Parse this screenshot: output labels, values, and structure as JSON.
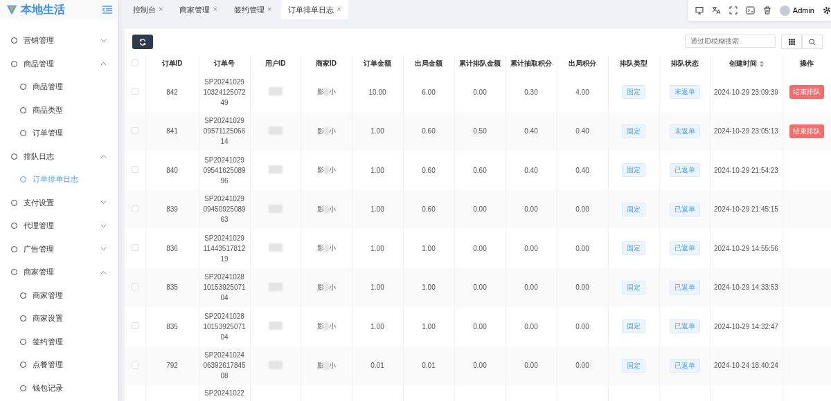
{
  "brand": {
    "title": "本地生活"
  },
  "sidebar": {
    "items": [
      {
        "label": "营销管理",
        "expanded": false
      },
      {
        "label": "商品管理",
        "expanded": true,
        "children": [
          {
            "label": "商品管理",
            "selected": false
          },
          {
            "label": "商品类型",
            "selected": false
          },
          {
            "label": "订单管理",
            "selected": false
          }
        ]
      },
      {
        "label": "排队日志",
        "expanded": true,
        "children": [
          {
            "label": "订单排单日志",
            "selected": true
          }
        ]
      },
      {
        "label": "支付设置",
        "expanded": false
      },
      {
        "label": "代理管理",
        "expanded": false
      },
      {
        "label": "广告管理",
        "expanded": false
      },
      {
        "label": "商家管理",
        "expanded": true,
        "children": [
          {
            "label": "商家管理",
            "selected": false
          },
          {
            "label": "商家设置",
            "selected": false
          },
          {
            "label": "签约管理",
            "selected": false
          },
          {
            "label": "点餐管理",
            "selected": false
          },
          {
            "label": "钱包记录",
            "selected": false
          }
        ]
      }
    ]
  },
  "tabs": [
    {
      "label": "控制台",
      "close": "×",
      "selected": false
    },
    {
      "label": "商家管理",
      "close": "×",
      "selected": false
    },
    {
      "label": "签约管理",
      "close": "×",
      "selected": false
    },
    {
      "label": "订单排单日志",
      "close": "×",
      "selected": true
    }
  ],
  "user": {
    "name": "Admin"
  },
  "search": {
    "placeholder": "通过ID模糊搜索"
  },
  "table": {
    "select_all": {
      "checked": false
    },
    "columns": [
      "订单ID",
      "订单号",
      "用户ID",
      "商家ID",
      "订单金额",
      "出局金额",
      "累计排队金额",
      "累计抽取积分",
      "出局积分",
      "排队类型",
      "排队状态",
      "创建时间",
      "操作"
    ],
    "rows": [
      {
        "checked": false,
        "id": "842",
        "order_no": [
          "SP20241029",
          "10324125072",
          "49"
        ],
        "merchant": [
          "影",
          "小"
        ],
        "amount": "10.00",
        "out_amount": "6.00",
        "queue_total": "0.00",
        "points_total": "0.30",
        "out_points": "4.00",
        "type": "固定",
        "status": "未返单",
        "created": "2024-10-29 23:09:39",
        "action": "结束排队"
      },
      {
        "checked": false,
        "id": "841",
        "order_no": [
          "SP20241029",
          "09571125066",
          "14"
        ],
        "merchant": [
          "影",
          "小"
        ],
        "amount": "1.00",
        "out_amount": "0.60",
        "queue_total": "0.50",
        "points_total": "0.40",
        "out_points": "0.40",
        "type": "固定",
        "status": "未返单",
        "created": "2024-10-29 23:05:13",
        "action": "结束排队"
      },
      {
        "checked": false,
        "id": "840",
        "order_no": [
          "SP20241029",
          "09541625089",
          "96"
        ],
        "merchant": [
          "影",
          "小"
        ],
        "amount": "1.00",
        "out_amount": "0.60",
        "queue_total": "0.60",
        "points_total": "0.40",
        "out_points": "0.40",
        "type": "固定",
        "status": "已返单",
        "created": "2024-10-29 21:54:23"
      },
      {
        "checked": false,
        "id": "839",
        "order_no": [
          "SP20241029",
          "09450925089",
          "63"
        ],
        "merchant": [
          "影",
          "小"
        ],
        "amount": "1.00",
        "out_amount": "0.60",
        "queue_total": "0.00",
        "points_total": "0.00",
        "out_points": "0.00",
        "type": "固定",
        "status": "已返单",
        "created": "2024-10-29 21:45:15"
      },
      {
        "checked": false,
        "id": "836",
        "order_no": [
          "SP20241029",
          "11443517812",
          "19"
        ],
        "merchant": [
          "影",
          "小"
        ],
        "amount": "1.00",
        "out_amount": "1.00",
        "queue_total": "0.00",
        "points_total": "0.00",
        "out_points": "0.00",
        "type": "固定",
        "status": "已返单",
        "created": "2024-10-29 14:55:56"
      },
      {
        "checked": false,
        "id": "835",
        "order_no": [
          "SP20241028",
          "10153925071",
          "04"
        ],
        "merchant": [
          "影",
          "小"
        ],
        "amount": "1.00",
        "out_amount": "1.00",
        "queue_total": "0.00",
        "points_total": "0.00",
        "out_points": "0.00",
        "type": "固定",
        "status": "已返单",
        "created": "2024-10-29 14:33:53"
      },
      {
        "checked": false,
        "id": "835",
        "order_no": [
          "SP20241028",
          "10153925071",
          "04"
        ],
        "merchant": [
          "影",
          "小"
        ],
        "amount": "1.00",
        "out_amount": "1.00",
        "queue_total": "0.00",
        "points_total": "0.00",
        "out_points": "0.00",
        "type": "固定",
        "status": "已返单",
        "created": "2024-10-29 14:32:47"
      },
      {
        "checked": false,
        "id": "792",
        "order_no": [
          "SP20241024",
          "06392617845",
          "08"
        ],
        "merchant": [
          "影",
          "小"
        ],
        "amount": "0.01",
        "out_amount": "0.01",
        "queue_total": "0.00",
        "points_total": "0.00",
        "out_points": "0.00",
        "type": "固定",
        "status": "已返单",
        "created": "2024-10-24 18:40:24"
      },
      {
        "order_no": [
          "SP20241022"
        ]
      }
    ]
  }
}
